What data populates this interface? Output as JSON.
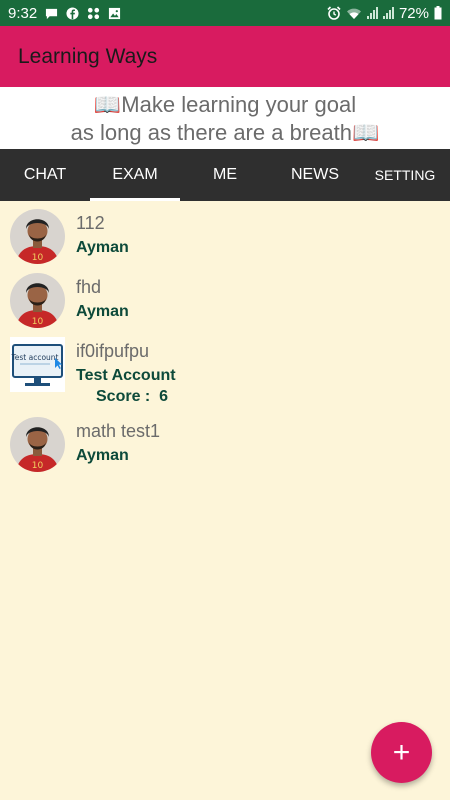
{
  "status_bar": {
    "time": "9:32",
    "battery": "72%",
    "left_icons": [
      "chat-bubble-icon",
      "facebook-icon",
      "apps-icon",
      "image-icon"
    ],
    "right_icons": [
      "alarm-icon",
      "wifi-icon",
      "signal-icon",
      "signal-icon",
      "battery-icon"
    ]
  },
  "app_bar": {
    "title": "Learning Ways"
  },
  "motto": {
    "line1": "📖Make learning your goal",
    "line2": "as long as there are a breath📖"
  },
  "tabs": [
    {
      "label": "CHAT",
      "active": false
    },
    {
      "label": "EXAM",
      "active": true
    },
    {
      "label": "ME",
      "active": false
    },
    {
      "label": "NEWS",
      "active": false
    },
    {
      "label": "SETTING",
      "active": false
    }
  ],
  "exams": [
    {
      "title": "112",
      "author": "Ayman",
      "avatar": "player-photo"
    },
    {
      "title": "fhd",
      "author": "Ayman",
      "avatar": "player-photo"
    },
    {
      "title": "if0ifpufpu",
      "author": "Test Account",
      "score_label": "Score :",
      "score_value": "6",
      "avatar": "test-account-image",
      "avatar_text": "Test account"
    },
    {
      "title": "math test1",
      "author": "Ayman",
      "avatar": "player-photo"
    }
  ],
  "fab": {
    "label": "+"
  },
  "colors": {
    "primary": "#d81b60",
    "status_bar": "#1a6b3c",
    "tab_bar": "#2f2f2f",
    "background": "#fdf5d9",
    "author_text": "#0d4a3a"
  }
}
